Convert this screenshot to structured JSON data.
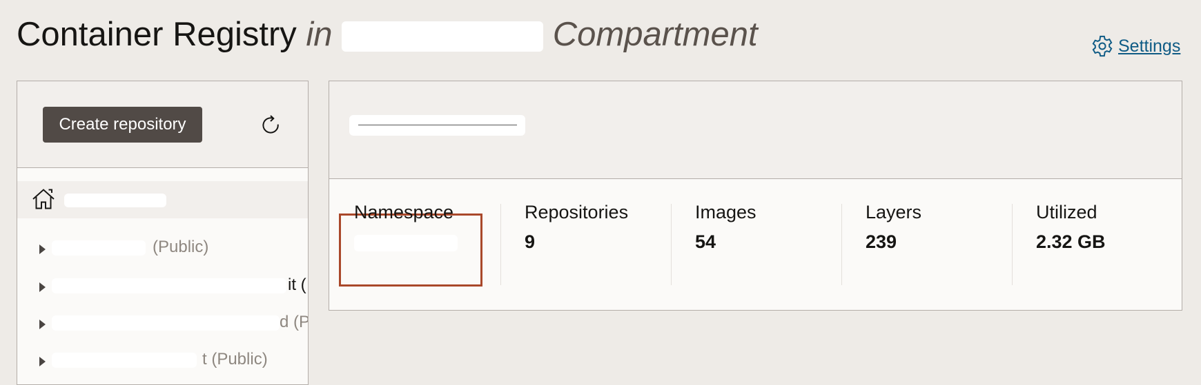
{
  "header": {
    "title_main": "Container Registry",
    "title_in": "in",
    "title_compartment": "Compartment",
    "settings_label": "Settings"
  },
  "sidebar": {
    "create_button": "Create repository",
    "items": [
      {
        "tail": "(Public)"
      },
      {
        "tail": "it ("
      },
      {
        "tail": "d (Pu"
      },
      {
        "tail": "t (Public)"
      }
    ]
  },
  "stats": [
    {
      "label": "Namespace",
      "value": ""
    },
    {
      "label": "Repositories",
      "value": "9"
    },
    {
      "label": "Images",
      "value": "54"
    },
    {
      "label": "Layers",
      "value": "239"
    },
    {
      "label": "Utilized",
      "value": "2.32 GB"
    }
  ],
  "colors": {
    "accent": "#0f5b85",
    "button": "#514a46",
    "highlight": "#a9482a"
  }
}
